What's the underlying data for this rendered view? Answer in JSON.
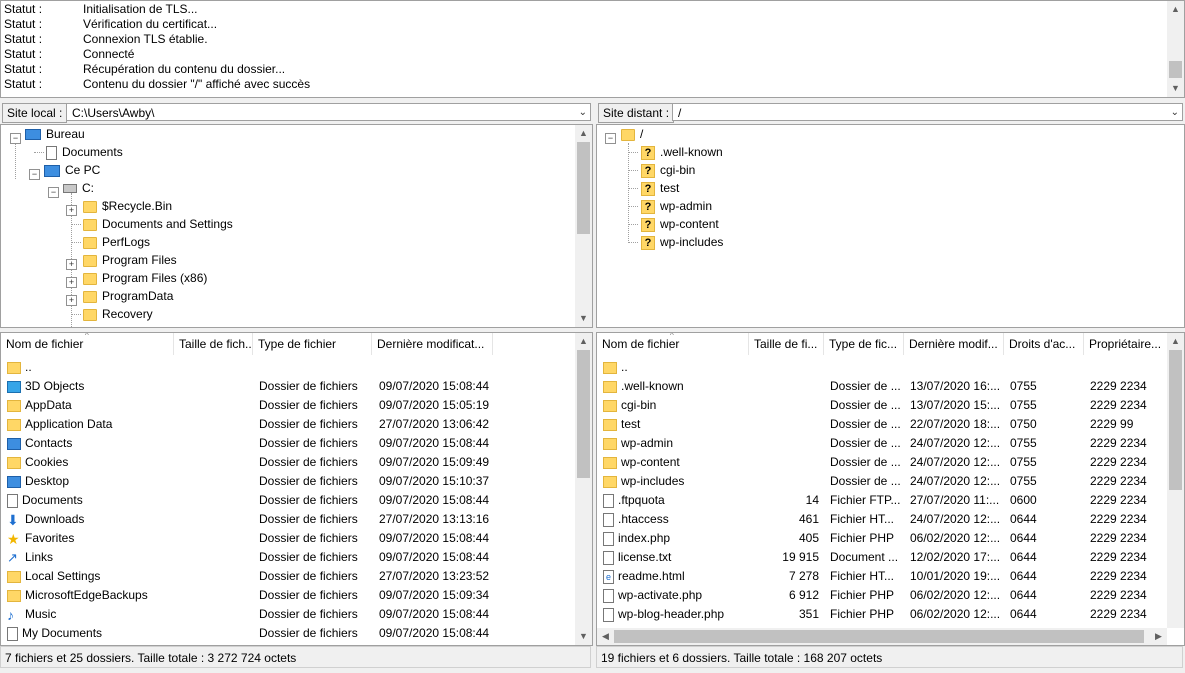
{
  "log": [
    {
      "k": "Statut :",
      "v": "Initialisation de TLS..."
    },
    {
      "k": "Statut :",
      "v": "Vérification du certificat..."
    },
    {
      "k": "Statut :",
      "v": "Connexion TLS établie."
    },
    {
      "k": "Statut :",
      "v": "Connecté"
    },
    {
      "k": "Statut :",
      "v": "Récupération du contenu du dossier..."
    },
    {
      "k": "Statut :",
      "v": "Contenu du dossier \"/\" affiché avec succès"
    }
  ],
  "local": {
    "site_label": "Site local :",
    "path": "C:\\Users\\Awby\\",
    "tree": [
      "Bureau",
      "Documents",
      "Ce PC",
      "C:",
      "$Recycle.Bin",
      "Documents and Settings",
      "PerfLogs",
      "Program Files",
      "Program Files (x86)",
      "ProgramData",
      "Recovery"
    ],
    "headers": [
      "Nom de fichier",
      "Taille de fich...",
      "Type de fichier",
      "Dernière modificat..."
    ],
    "rows": [
      {
        "name": "..",
        "size": "",
        "type": "",
        "date": "",
        "icon": "folder"
      },
      {
        "name": "3D Objects",
        "size": "",
        "type": "Dossier de fichiers",
        "date": "09/07/2020 15:08:44",
        "icon": "cube"
      },
      {
        "name": "AppData",
        "size": "",
        "type": "Dossier de fichiers",
        "date": "09/07/2020 15:05:19",
        "icon": "folder"
      },
      {
        "name": "Application Data",
        "size": "",
        "type": "Dossier de fichiers",
        "date": "27/07/2020 13:06:42",
        "icon": "folder"
      },
      {
        "name": "Contacts",
        "size": "",
        "type": "Dossier de fichiers",
        "date": "09/07/2020 15:08:44",
        "icon": "blue"
      },
      {
        "name": "Cookies",
        "size": "",
        "type": "Dossier de fichiers",
        "date": "09/07/2020 15:09:49",
        "icon": "folder"
      },
      {
        "name": "Desktop",
        "size": "",
        "type": "Dossier de fichiers",
        "date": "09/07/2020 15:10:37",
        "icon": "blue"
      },
      {
        "name": "Documents",
        "size": "",
        "type": "Dossier de fichiers",
        "date": "09/07/2020 15:08:44",
        "icon": "doc"
      },
      {
        "name": "Downloads",
        "size": "",
        "type": "Dossier de fichiers",
        "date": "27/07/2020 13:13:16",
        "icon": "down"
      },
      {
        "name": "Favorites",
        "size": "",
        "type": "Dossier de fichiers",
        "date": "09/07/2020 15:08:44",
        "icon": "star"
      },
      {
        "name": "Links",
        "size": "",
        "type": "Dossier de fichiers",
        "date": "09/07/2020 15:08:44",
        "icon": "link"
      },
      {
        "name": "Local Settings",
        "size": "",
        "type": "Dossier de fichiers",
        "date": "27/07/2020 13:23:52",
        "icon": "folder"
      },
      {
        "name": "MicrosoftEdgeBackups",
        "size": "",
        "type": "Dossier de fichiers",
        "date": "09/07/2020 15:09:34",
        "icon": "folder"
      },
      {
        "name": "Music",
        "size": "",
        "type": "Dossier de fichiers",
        "date": "09/07/2020 15:08:44",
        "icon": "music"
      },
      {
        "name": "My Documents",
        "size": "",
        "type": "Dossier de fichiers",
        "date": "09/07/2020 15:08:44",
        "icon": "doc"
      }
    ],
    "status": "7 fichiers et 25 dossiers. Taille totale : 3 272 724 octets"
  },
  "remote": {
    "site_label": "Site distant :",
    "path": "/",
    "tree": [
      "/",
      ".well-known",
      "cgi-bin",
      "test",
      "wp-admin",
      "wp-content",
      "wp-includes"
    ],
    "headers": [
      "Nom de fichier",
      "Taille de fi...",
      "Type de fic...",
      "Dernière modif...",
      "Droits d'ac...",
      "Propriétaire..."
    ],
    "rows": [
      {
        "name": "..",
        "size": "",
        "type": "",
        "date": "",
        "perm": "",
        "owner": "",
        "icon": "folder"
      },
      {
        "name": ".well-known",
        "size": "",
        "type": "Dossier de ...",
        "date": "13/07/2020 16:...",
        "perm": "0755",
        "owner": "2229 2234",
        "icon": "folder"
      },
      {
        "name": "cgi-bin",
        "size": "",
        "type": "Dossier de ...",
        "date": "13/07/2020 15:...",
        "perm": "0755",
        "owner": "2229 2234",
        "icon": "folder"
      },
      {
        "name": "test",
        "size": "",
        "type": "Dossier de ...",
        "date": "22/07/2020 18:...",
        "perm": "0750",
        "owner": "2229 99",
        "icon": "folder"
      },
      {
        "name": "wp-admin",
        "size": "",
        "type": "Dossier de ...",
        "date": "24/07/2020 12:...",
        "perm": "0755",
        "owner": "2229 2234",
        "icon": "folder"
      },
      {
        "name": "wp-content",
        "size": "",
        "type": "Dossier de ...",
        "date": "24/07/2020 12:...",
        "perm": "0755",
        "owner": "2229 2234",
        "icon": "folder"
      },
      {
        "name": "wp-includes",
        "size": "",
        "type": "Dossier de ...",
        "date": "24/07/2020 12:...",
        "perm": "0755",
        "owner": "2229 2234",
        "icon": "folder"
      },
      {
        "name": ".ftpquota",
        "size": "14",
        "type": "Fichier FTP...",
        "date": "27/07/2020 11:...",
        "perm": "0600",
        "owner": "2229 2234",
        "icon": "doc"
      },
      {
        "name": ".htaccess",
        "size": "461",
        "type": "Fichier HT...",
        "date": "24/07/2020 12:...",
        "perm": "0644",
        "owner": "2229 2234",
        "icon": "doc"
      },
      {
        "name": "index.php",
        "size": "405",
        "type": "Fichier PHP",
        "date": "06/02/2020 12:...",
        "perm": "0644",
        "owner": "2229 2234",
        "icon": "doc"
      },
      {
        "name": "license.txt",
        "size": "19 915",
        "type": "Document ...",
        "date": "12/02/2020 17:...",
        "perm": "0644",
        "owner": "2229 2234",
        "icon": "doc"
      },
      {
        "name": "readme.html",
        "size": "7 278",
        "type": "Fichier HT...",
        "date": "10/01/2020 19:...",
        "perm": "0644",
        "owner": "2229 2234",
        "icon": "html"
      },
      {
        "name": "wp-activate.php",
        "size": "6 912",
        "type": "Fichier PHP",
        "date": "06/02/2020 12:...",
        "perm": "0644",
        "owner": "2229 2234",
        "icon": "doc"
      },
      {
        "name": "wp-blog-header.php",
        "size": "351",
        "type": "Fichier PHP",
        "date": "06/02/2020 12:...",
        "perm": "0644",
        "owner": "2229 2234",
        "icon": "doc"
      }
    ],
    "status": "19 fichiers et 6 dossiers. Taille totale : 168 207 octets"
  }
}
